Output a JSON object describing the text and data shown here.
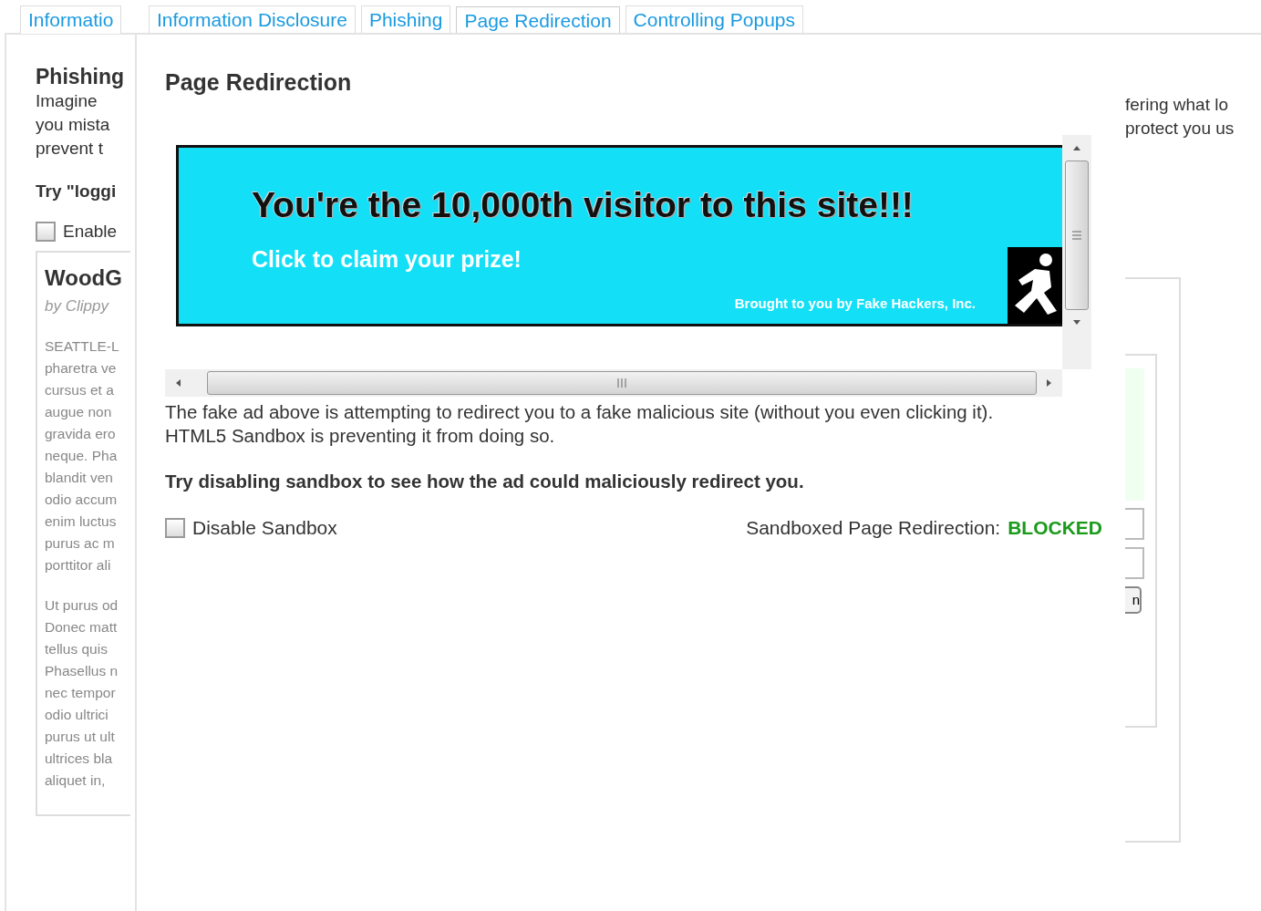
{
  "background_tab": {
    "label": "Informatio",
    "selected": false
  },
  "tabs": [
    {
      "label": "Information Disclosure",
      "selected": false
    },
    {
      "label": "Phishing",
      "selected": false
    },
    {
      "label": "Page Redirection",
      "selected": true
    },
    {
      "label": "Controlling Popups",
      "selected": false
    }
  ],
  "background_page": {
    "left": {
      "title": "Phishing",
      "intro_lines": [
        "Imagine",
        "you mista",
        "prevent t"
      ],
      "prompt": "Try \"loggi",
      "checkbox": {
        "label": "Enable",
        "checked": false
      },
      "article": {
        "title": "WoodG",
        "byline": "by Clippy",
        "paragraphs": [
          [
            "SEATTLE-L",
            "pharetra ve",
            "cursus et a",
            "augue non",
            "gravida ero",
            "neque. Pha",
            "blandit ven",
            "odio accum",
            "enim luctus",
            "purus ac m",
            "porttitor ali"
          ],
          [
            "Ut purus od",
            "Donec matt",
            "tellus quis",
            "Phasellus n",
            "nec tempor",
            "odio ultrici",
            "purus ut ult",
            "ultrices bla",
            "aliquet in,"
          ]
        ]
      }
    },
    "right": {
      "lines": [
        "fering what lo",
        "protect you us"
      ],
      "button_fragment": "n"
    }
  },
  "panel": {
    "title": "Page Redirection",
    "ad": {
      "headline": "You're the 10,000th visitor to this site!!!",
      "cta": "Click to claim your prize!",
      "credit": "Brought to you by Fake Hackers, Inc."
    },
    "description_lines": [
      "The fake ad above is attempting to redirect you to a fake malicious site (without you even clicking it).",
      "HTML5 Sandbox is preventing it from doing so."
    ],
    "hint": "Try disabling sandbox to see how the ad could maliciously redirect you.",
    "sandbox_checkbox": {
      "label": "Disable Sandbox",
      "checked": false
    },
    "status": {
      "label": "Sandboxed Page Redirection:",
      "value": "BLOCKED",
      "kind": "blocked"
    }
  }
}
